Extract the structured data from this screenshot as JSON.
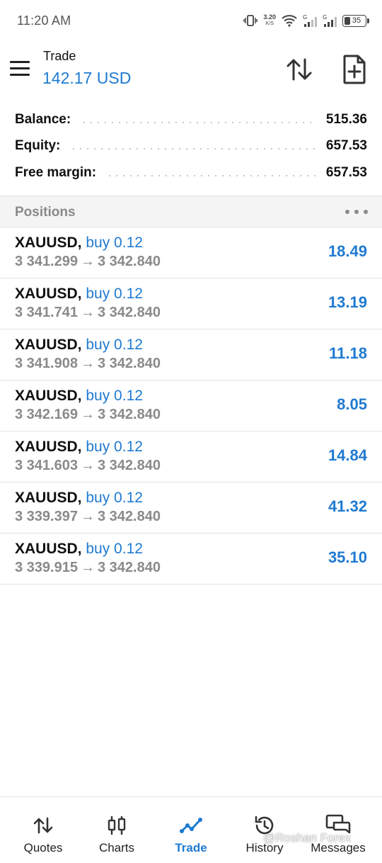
{
  "status_bar": {
    "time": "11:20 AM",
    "net_speed": "3.20",
    "net_speed_unit": "K/S",
    "battery": "35"
  },
  "header": {
    "title": "Trade",
    "subtitle": "142.17 USD"
  },
  "summary": [
    {
      "label": "Balance:",
      "value": "515.36"
    },
    {
      "label": "Equity:",
      "value": "657.53"
    },
    {
      "label": "Free margin:",
      "value": "657.53"
    }
  ],
  "positions_section": {
    "title": "Positions"
  },
  "positions": [
    {
      "symbol": "XAUUSD,",
      "side": "buy 0.12",
      "open_price": "3 341.299",
      "current_price": "3 342.840",
      "profit": "18.49"
    },
    {
      "symbol": "XAUUSD,",
      "side": "buy 0.12",
      "open_price": "3 341.741",
      "current_price": "3 342.840",
      "profit": "13.19"
    },
    {
      "symbol": "XAUUSD,",
      "side": "buy 0.12",
      "open_price": "3 341.908",
      "current_price": "3 342.840",
      "profit": "11.18"
    },
    {
      "symbol": "XAUUSD,",
      "side": "buy 0.12",
      "open_price": "3 342.169",
      "current_price": "3 342.840",
      "profit": "8.05"
    },
    {
      "symbol": "XAUUSD,",
      "side": "buy 0.12",
      "open_price": "3 341.603",
      "current_price": "3 342.840",
      "profit": "14.84"
    },
    {
      "symbol": "XAUUSD,",
      "side": "buy 0.12",
      "open_price": "3 339.397",
      "current_price": "3 342.840",
      "profit": "41.32"
    },
    {
      "symbol": "XAUUSD,",
      "side": "buy 0.12",
      "open_price": "3 339.915",
      "current_price": "3 342.840",
      "profit": "35.10"
    }
  ],
  "arrow_glyph": "→",
  "bottom_nav": [
    {
      "label": "Quotes",
      "icon": "quotes-arrows-icon",
      "active": false
    },
    {
      "label": "Charts",
      "icon": "candlestick-icon",
      "active": false
    },
    {
      "label": "Trade",
      "icon": "trade-line-icon",
      "active": true
    },
    {
      "label": "History",
      "icon": "history-clock-icon",
      "active": false
    },
    {
      "label": "Messages",
      "icon": "chat-bubbles-icon",
      "active": false
    }
  ],
  "watermark": "@Roshan Forex",
  "colors": {
    "accent": "#1f7ad1",
    "muted": "#8a8a8a",
    "section_bg": "#f4f4f4"
  }
}
